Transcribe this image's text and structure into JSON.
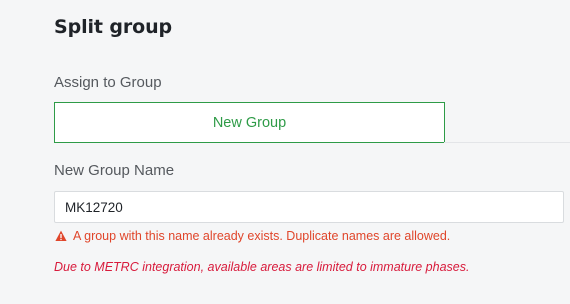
{
  "dialog": {
    "title": "Split group"
  },
  "assign": {
    "label": "Assign to Group",
    "selected_option": "New Group"
  },
  "new_group": {
    "label": "New Group Name",
    "value": "MK12720"
  },
  "messages": {
    "duplicate_warning": "A group with this name already exists. Duplicate names are allowed.",
    "metrc_note": "Due to METRC integration, available areas are limited to immature phases."
  },
  "icons": {
    "warning": "warning-triangle-icon"
  },
  "colors": {
    "accent_green": "#2e9b47",
    "warning_orange": "#e0462b",
    "note_red": "#d81b3c",
    "title_text": "#1f2328",
    "label_text": "#55595e",
    "background": "#f5f6f7"
  }
}
